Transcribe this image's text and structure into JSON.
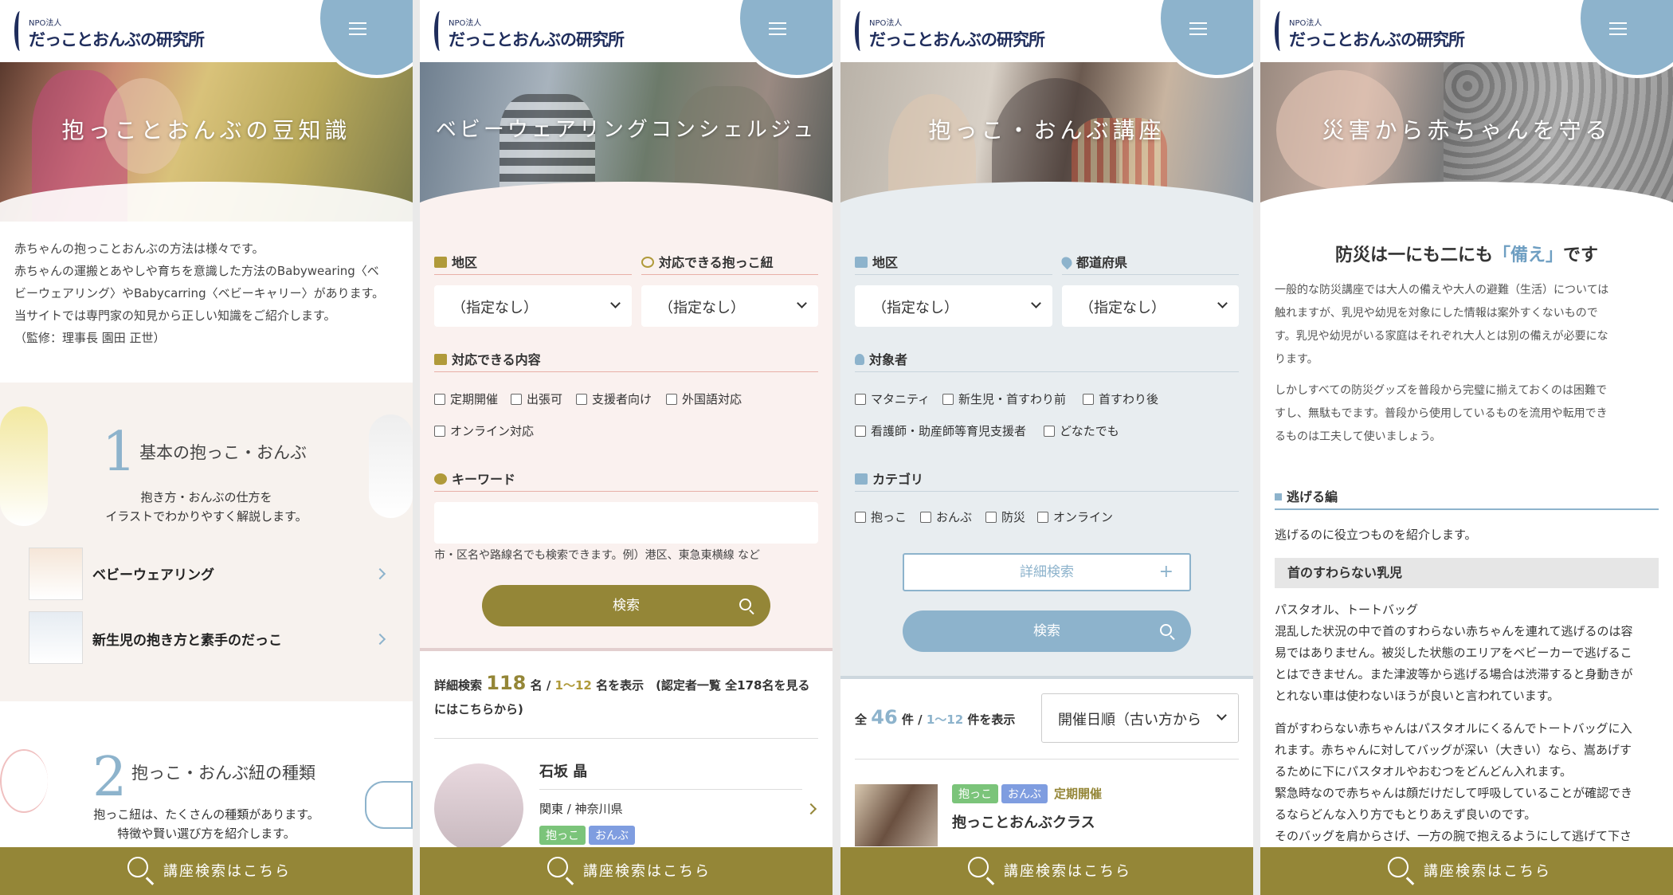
{
  "logo": {
    "npo": "NPO法人",
    "name": "だっことおんぶの研究所"
  },
  "bottom_bar": {
    "label": "講座検索はこちら"
  },
  "p1": {
    "hero_title": "抱っことおんぶの豆知識",
    "intro": [
      "赤ちゃんの抱っことおんぶの方法は様々です。",
      "赤ちゃんの運搬とあやしや育ちを意識した方法のBabywearing〈ベ",
      "ビーウェアリング〉やBabycarring〈ベビーキャリー〉があります。",
      "当サイトでは専門家の知見から正しい知識をご紹介します。",
      "（監修：理事長 園田 正世）"
    ],
    "sec1": {
      "num": "1",
      "title": "基本の抱っこ・おんぶ",
      "desc1": "抱き方・おんぶの仕方を",
      "desc2": "イラストでわかりやすく解説します。"
    },
    "links": [
      "ベビーウェアリング",
      "新生児の抱き方と素手のだっこ"
    ],
    "sec2": {
      "num": "2",
      "title": "抱っこ・おんぶ紐の種類",
      "desc1": "抱っこ紐は、たくさんの種類があります。",
      "desc2": "特徴や賢い選び方を紹介します。"
    }
  },
  "p2": {
    "hero_title": "ベビーウェアリングコンシェルジュ",
    "area_label": "地区",
    "carrier_label": "対応できる抱っこ紐",
    "area_value": "（指定なし）",
    "carrier_value": "（指定なし）",
    "content_label": "対応できる内容",
    "checks": [
      "定期開催",
      "出張可",
      "支援者向け",
      "外国語対応",
      "オンライン対応"
    ],
    "keyword_label": "キーワード",
    "keyword_note": "市・区名や路線名でも検索できます。例）港区、東急東横線 など",
    "search_btn": "検索",
    "result_prefix": "詳細検索",
    "result_count": "118",
    "result_mid": "名 /",
    "result_range": "1〜12",
    "result_suffix": "名を表示　(認定者一覧 全178名を見る",
    "result_line2": "にはこちらから)",
    "person": {
      "name": "石坂 晶",
      "region": "関東 / 神奈川県",
      "tags": [
        "抱っこ",
        "おんぶ"
      ]
    }
  },
  "p3": {
    "hero_title": "抱っこ・おんぶ講座",
    "area_label": "地区",
    "pref_label": "都道府県",
    "area_value": "（指定なし）",
    "pref_value": "（指定なし）",
    "target_label": "対象者",
    "targets": [
      "マタニティ",
      "新生児・首すわり前",
      "首すわり後",
      "看護師・助産師等育児支援者",
      "どなたでも"
    ],
    "cat_label": "カテゴリ",
    "cats": [
      "抱っこ",
      "おんぶ",
      "防災",
      "オンライン"
    ],
    "detail_btn": "詳細検索",
    "search_btn": "検索",
    "result_prefix": "全",
    "result_count": "46",
    "result_mid": "件 /",
    "result_range": "1〜12",
    "result_suffix": "件を表示",
    "sort_value": "開催日順（古い方から",
    "course": {
      "tags": [
        "抱っこ",
        "おんぶ"
      ],
      "tag_plain": "定期開催",
      "title": "抱っことおんぶクラス"
    }
  },
  "p4": {
    "hero_title": "災害から赤ちゃんを守る",
    "heading_a": "防災は一にも二にも",
    "heading_b": "「備え」",
    "heading_c": "です",
    "para1": [
      "一般的な防災講座では大人の備えや大人の避難（生活）については",
      "触れますが、乳児や幼児を対象にした情報は案外すくないもので",
      "す。乳児や幼児がいる家庭はそれぞれ大人とは別の備えが必要にな",
      "ります。"
    ],
    "para2": [
      "しかしすべての防災グッズを普段から完璧に揃えておくのは困難で",
      "すし、無駄もでます。普段から使用しているものを流用や転用でき",
      "るものは工夫して使いましょう。"
    ],
    "sub_heading": "逃げる編",
    "sub_desc": "逃げるのに役立つものを紹介します。",
    "box": "首のすわらない乳児",
    "items": "パスタオル、トートバッグ",
    "para3": [
      "混乱した状況の中で首のすわらない赤ちゃんを連れて逃げるのは容",
      "易ではありません。被災した状態のエリアをベビーカーで逃げるこ",
      "とはできません。また津波等から逃げる場合は渋滞すると身動きが",
      "とれない車は使わないほうが良いと言われています。"
    ],
    "para4": [
      "首がすわらない赤ちゃんはパスタオルにくるんでトートバッグに入",
      "れます。赤ちゃんに対してバッグが深い（大きい）なら、嵩あげす",
      "るために下にパスタオルやおむつをどんどん入れます。",
      "緊急時なので赤ちゃんは顔だけだして呼吸していることが確認でき",
      "るならどんな入り方でもとりあえず良いのです。",
      "そのバッグを肩からさげ、一方の腕で抱えるようにして逃げて下さ"
    ]
  },
  "colors": {
    "olive": "#948637",
    "blue": "#8db3cc",
    "pink_bg": "#faf1ef",
    "gray_bg": "#e8edf0",
    "tag_green": "#7bc47a",
    "tag_blue": "#7f9de0"
  }
}
